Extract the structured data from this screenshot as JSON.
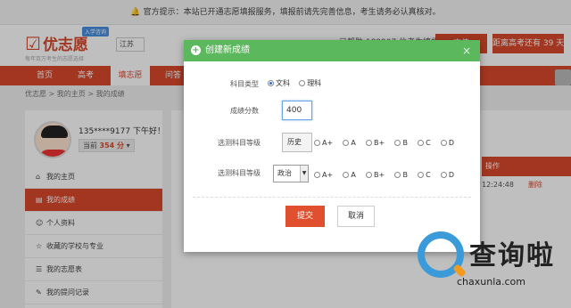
{
  "notice": {
    "text": "官方提示：本站已开通志愿填报服务，填报前请先完善信息，考生请务必认真核对。"
  },
  "header": {
    "logo_name": "优志愿",
    "logo_tag": "入学咨询",
    "slogan": "每年百万考生的志愿选择",
    "region": "江苏",
    "hot_text": "已帮助 189907 位考生填报志愿",
    "btn_primary": "充值",
    "btn_secondary": "距离高考还有 39 天"
  },
  "nav": {
    "items": [
      "首页",
      "高考",
      "填志愿",
      "问答"
    ],
    "active_index": 2
  },
  "breadcrumb": "优志愿 > 我的主页 > 我的成绩",
  "sidebar": {
    "user_name": "135****9177 下午好！",
    "score_prefix": "当前",
    "score_value": "354 分",
    "menu": [
      {
        "label": "我的主页",
        "icon": "home-icon"
      },
      {
        "label": "我的成绩",
        "icon": "document-icon"
      },
      {
        "label": "个人资料",
        "icon": "user-icon"
      },
      {
        "label": "收藏的学校与专业",
        "icon": "star-icon"
      },
      {
        "label": "我的志愿表",
        "icon": "list-icon"
      },
      {
        "label": "我的提问记录",
        "icon": "edit-icon"
      }
    ],
    "active_index": 1
  },
  "background_table": {
    "header": "操作",
    "row_time": "12:24:48",
    "row_action": "删除"
  },
  "modal": {
    "title": "创建新成绩",
    "close": "×",
    "subject_label": "科目类型",
    "subject_options": [
      "文科",
      "理科"
    ],
    "subject_selected": 0,
    "score_label": "成绩分数",
    "score_value": "400",
    "required_label": "选测科目等级",
    "required_subject": "历史",
    "optional_label": "选测科目等级",
    "optional_subject": "政治",
    "grades": [
      "A+",
      "A",
      "B+",
      "B",
      "C",
      "D"
    ],
    "submit": "提交",
    "cancel": "取消"
  },
  "watermark": {
    "cn": "查询啦",
    "en": "chaxunla.com"
  }
}
